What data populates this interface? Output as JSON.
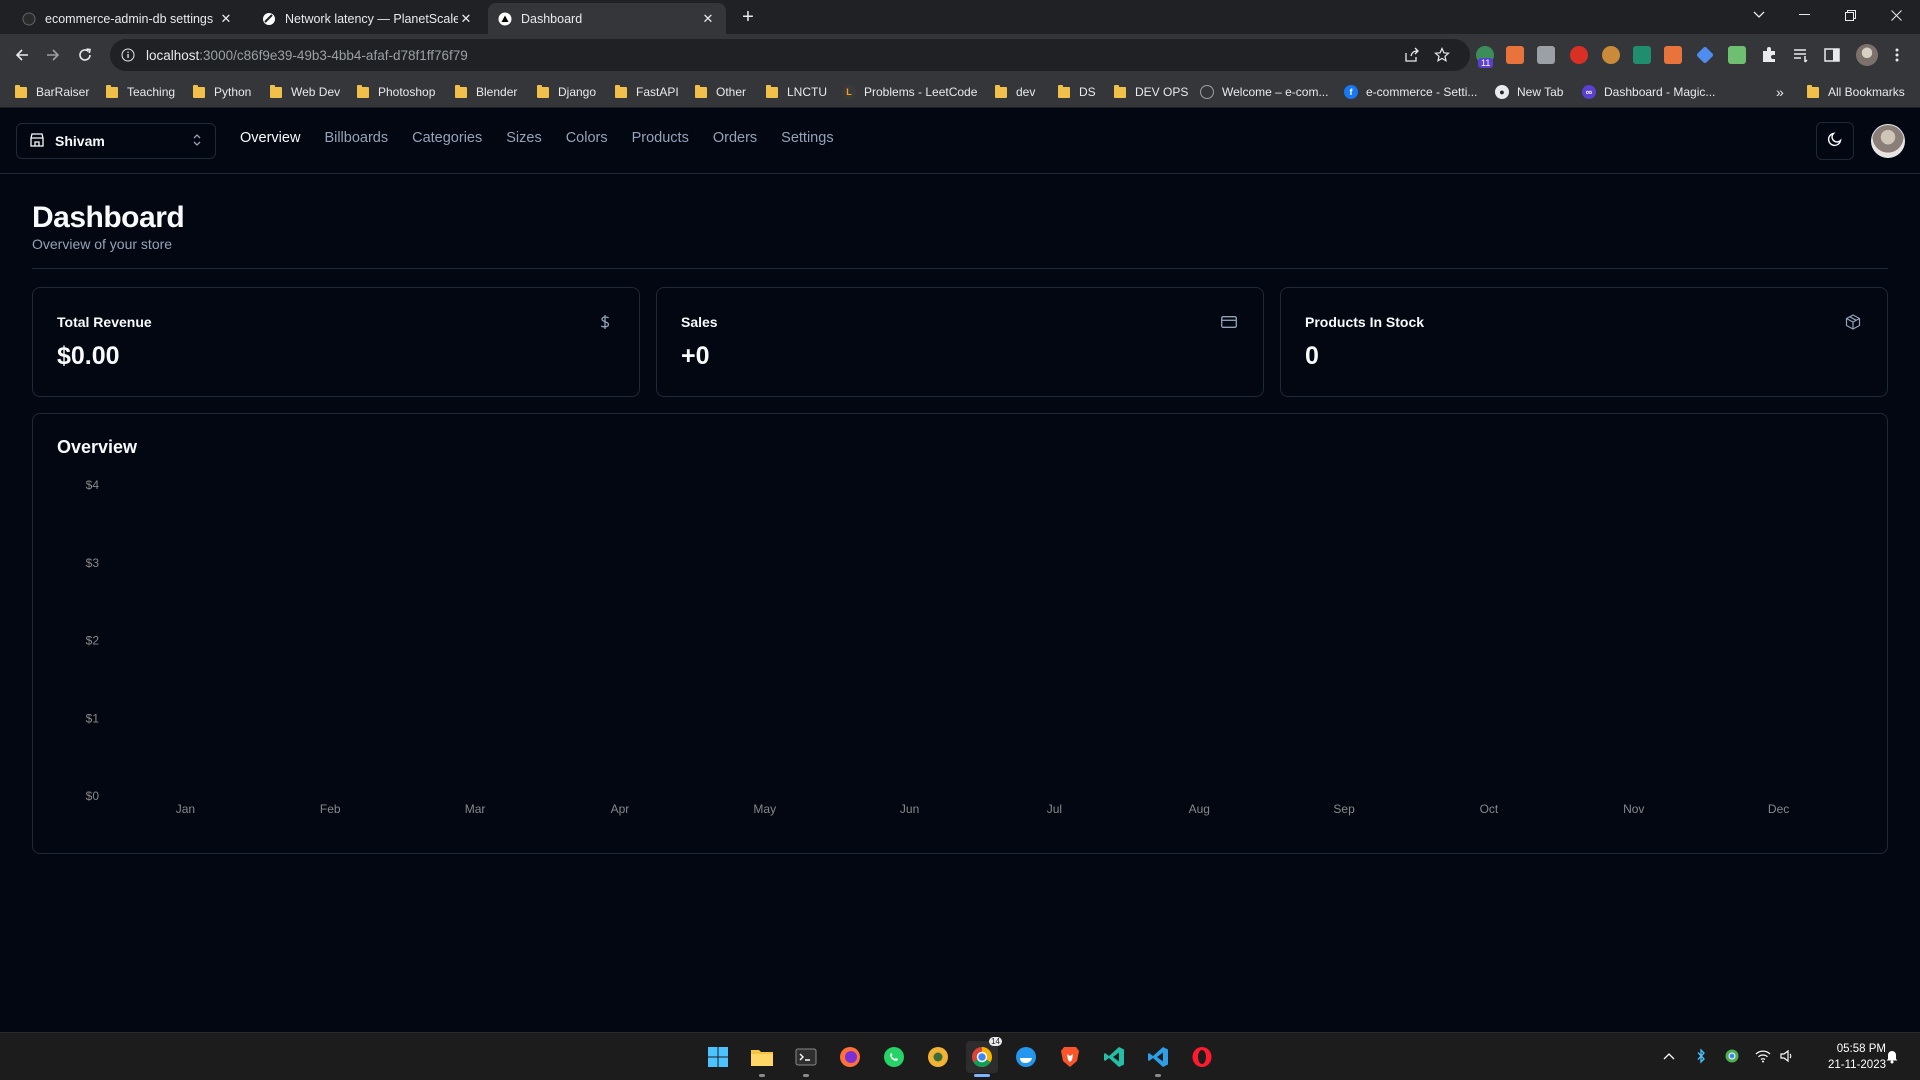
{
  "browser": {
    "tabs": [
      {
        "title": "ecommerce-admin-db settings",
        "active": false
      },
      {
        "title": "Network latency — PlanetScale | Ne",
        "active": false
      },
      {
        "title": "Dashboard",
        "active": true
      }
    ],
    "new_tab_symbol": "+",
    "url_host": "localhost",
    "url_path": ":3000/c86f9e39-49b3-4bb4-afaf-d78f1ff76f79",
    "bookmarks": [
      {
        "label": "BarRaiser",
        "icon": "folder-icon"
      },
      {
        "label": "Teaching",
        "icon": "folder-icon"
      },
      {
        "label": "Python",
        "icon": "folder-icon"
      },
      {
        "label": "Web Dev",
        "icon": "folder-icon"
      },
      {
        "label": "Photoshop",
        "icon": "folder-icon"
      },
      {
        "label": "Blender",
        "icon": "folder-icon"
      },
      {
        "label": "Django",
        "icon": "folder-icon"
      },
      {
        "label": "FastAPI",
        "icon": "folder-icon"
      },
      {
        "label": "Other",
        "icon": "folder-icon"
      },
      {
        "label": "LNCTU",
        "icon": "folder-icon"
      },
      {
        "label": "Problems - LeetCode",
        "icon": "leetcode-icon"
      },
      {
        "label": "dev",
        "icon": "folder-icon"
      },
      {
        "label": "DS",
        "icon": "folder-icon"
      },
      {
        "label": "DEV OPS",
        "icon": "folder-icon"
      },
      {
        "label": "Welcome – e-com...",
        "icon": "globe-icon"
      },
      {
        "label": "e-commerce - Setti...",
        "icon": "facebook-icon"
      },
      {
        "label": "New Tab",
        "icon": "github-icon"
      },
      {
        "label": "Dashboard - Magic...",
        "icon": "magic-icon"
      }
    ],
    "bookmarks_overflow": "»",
    "all_bookmarks": "All Bookmarks",
    "extension_badge": "11"
  },
  "app": {
    "store_name": "Shivam",
    "nav": [
      "Overview",
      "Billboards",
      "Categories",
      "Sizes",
      "Colors",
      "Products",
      "Orders",
      "Settings"
    ],
    "active_nav": "Overview",
    "title": "Dashboard",
    "subtitle": "Overview of your store",
    "cards": [
      {
        "label": "Total Revenue",
        "value": "$0.00",
        "icon": "dollar-icon"
      },
      {
        "label": "Sales",
        "value": "+0",
        "icon": "credit-card-icon"
      },
      {
        "label": "Products In Stock",
        "value": "0",
        "icon": "package-icon"
      }
    ],
    "overview_title": "Overview"
  },
  "chart_data": {
    "type": "bar",
    "title": "Overview",
    "categories": [
      "Jan",
      "Feb",
      "Mar",
      "Apr",
      "May",
      "Jun",
      "Jul",
      "Aug",
      "Sep",
      "Oct",
      "Nov",
      "Dec"
    ],
    "values": [
      0,
      0,
      0,
      0,
      0,
      0,
      0,
      0,
      0,
      0,
      0,
      0
    ],
    "y_ticks": [
      "$0",
      "$1",
      "$2",
      "$3",
      "$4"
    ],
    "ylim": [
      0,
      4
    ],
    "grid": false,
    "bar_color": "#adfa1d",
    "xlabel": "",
    "ylabel": ""
  },
  "taskbar": {
    "apps": [
      "windows-start-icon",
      "file-explorer-icon",
      "terminal-icon",
      "firefox-icon",
      "whatsapp-icon",
      "chrome-canary-icon",
      "chrome-icon",
      "docker-icon",
      "brave-icon",
      "vscode-insiders-icon",
      "vscode-icon",
      "opera-icon"
    ],
    "active_app": "chrome-icon",
    "chrome_badge": "14",
    "time": "05:58 PM",
    "date": "21-11-2023"
  },
  "colors": {
    "background": "#030712",
    "border": "#1f2937",
    "muted_text": "#94a3b8",
    "text": "#f8fafc"
  }
}
